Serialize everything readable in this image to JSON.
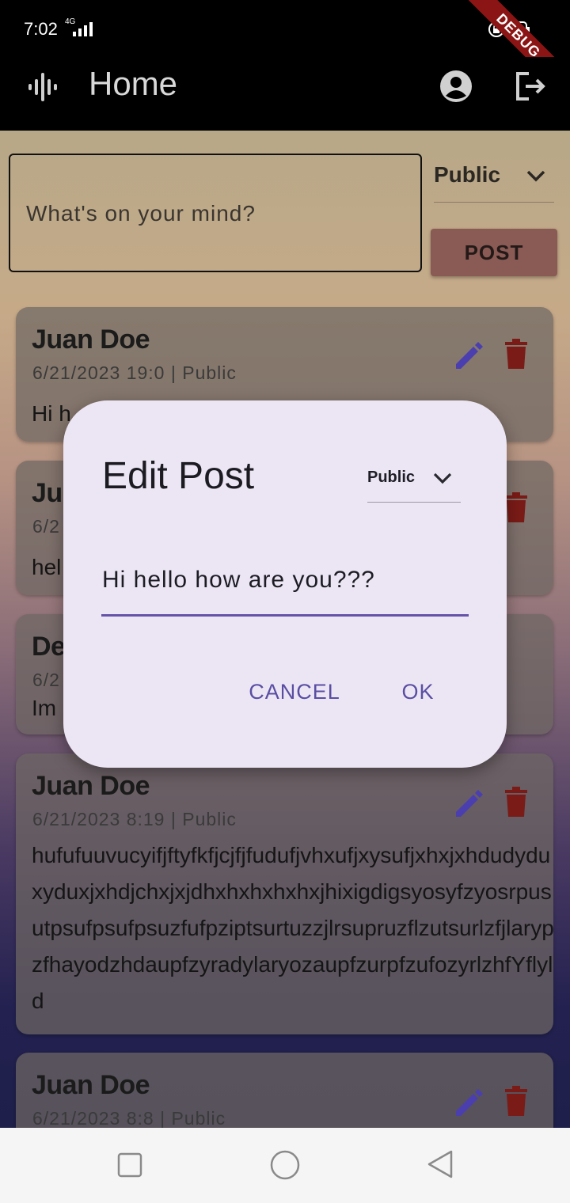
{
  "status_bar": {
    "time": "7:02",
    "network": "4G",
    "debug_banner": "DEBUG"
  },
  "app_bar": {
    "title": "Home",
    "icons": [
      "audio-logo-icon",
      "account-circle-icon",
      "logout-icon"
    ]
  },
  "composer": {
    "placeholder": "What's on your mind?",
    "visibility": "Public",
    "post_label": "POST"
  },
  "posts": [
    {
      "author": "Juan Doe",
      "meta": "6/21/2023 19:0 | Public",
      "body": "Hi h"
    },
    {
      "author": "Ju",
      "meta": "6/2",
      "body": "hel"
    },
    {
      "author": "De",
      "meta": "6/2",
      "body": "Im"
    },
    {
      "author": "Juan Doe",
      "meta": "6/21/2023 8:19 | Public",
      "body": "hufufuuvucyifjftyfkfjcjfjfudufjvhxufjxysufjxhxjxhdudyduxyduxjxhdjchxjxjdhxhxhxhxhxjhixigdigsyosyfzyosrpusutpsufpsufpsuzfufpziptsurtuzzjlrsupruzflzutsurlzfjlarypzfhayodzhdaupfzyradylaryozaupfzurpfzufozyrlzhfYflyld"
    },
    {
      "author": "Juan Doe",
      "meta": "6/21/2023 8:8 | Public",
      "body": ""
    }
  ],
  "dialog": {
    "title": "Edit Post",
    "visibility": "Public",
    "input_value": "Hi hello how are you???",
    "cancel_label": "CANCEL",
    "ok_label": "OK"
  },
  "colors": {
    "accent": "#5a4ea3",
    "delete": "#7a1b17",
    "edit": "#4b3fb0",
    "dialog_bg": "#ece6f4"
  }
}
